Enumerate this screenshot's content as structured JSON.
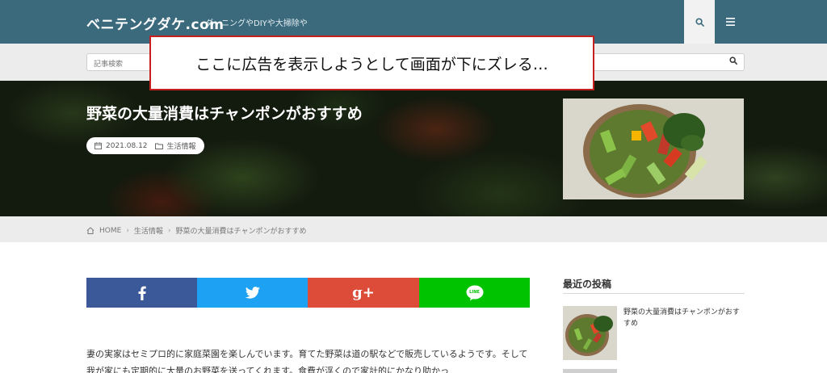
{
  "header": {
    "site_name": "ベニテングダケ.com",
    "tagline": "ダーニングやDIYや大掃除や",
    "search_icon": "search-icon",
    "menu_icon": "menu-icon",
    "bg_color": "#3c6a7d"
  },
  "search": {
    "placeholder": "記事検索"
  },
  "ad_overlay": {
    "text": "ここに広告を表示しようとして画面が下にズレる…",
    "border_color": "#c81e1e"
  },
  "hero": {
    "title": "野菜の大量消費はチャンポンがおすすめ",
    "date": "2021.08.12",
    "category": "生活情報"
  },
  "breadcrumb": {
    "home": "HOME",
    "category": "生活情報",
    "current": "野菜の大量消費はチャンポンがおすすめ"
  },
  "share": {
    "facebook_color": "#3b5998",
    "twitter_color": "#1da1f2",
    "googleplus_color": "#dd4b39",
    "googleplus_label": "g+",
    "line_color": "#00c300",
    "line_label": "LINE"
  },
  "article": {
    "body": "妻の実家はセミプロ的に家庭菜園を楽しんでいます。育てた野菜は道の駅などで販売しているようです。そして我が家にも定期的に大量のお野菜を送ってくれます。食費が浮くので家計的にかなり助かっ"
  },
  "sidebar": {
    "heading": "最近の投稿",
    "posts": [
      {
        "title": "野菜の大量消費はチャンポンがおすすめ"
      }
    ]
  }
}
